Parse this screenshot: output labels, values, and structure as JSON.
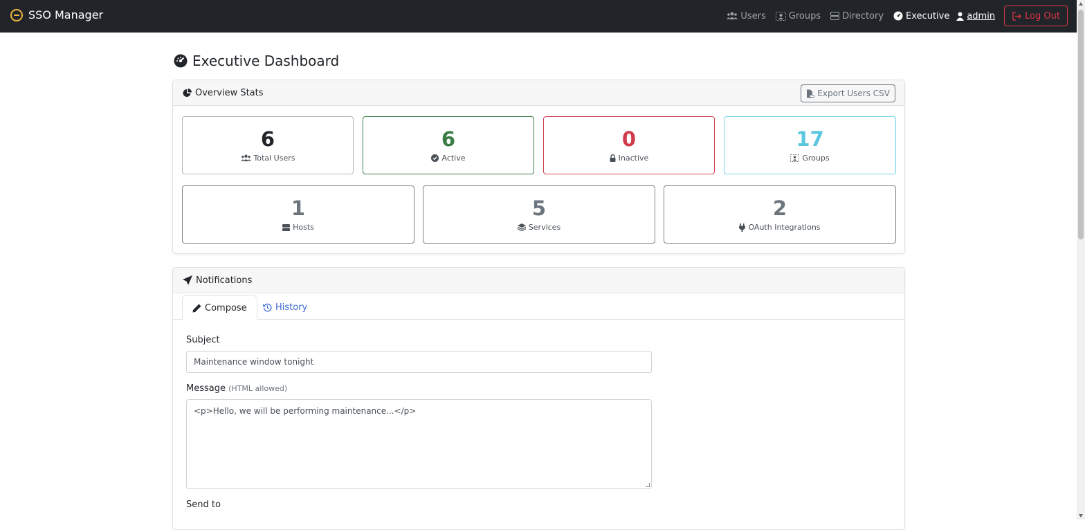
{
  "app": {
    "brand": "SSO Manager"
  },
  "nav": {
    "users": "Users",
    "groups": "Groups",
    "directory": "Directory",
    "executive": "Executive",
    "user": "admin",
    "logout": "Log Out"
  },
  "page": {
    "title": "Executive Dashboard"
  },
  "overview": {
    "header": "Overview Stats",
    "export_label": "Export Users CSV",
    "stats_top": [
      {
        "value": "6",
        "label": "Total Users",
        "color": "#212529",
        "border": "#adb5bd"
      },
      {
        "value": "6",
        "label": "Active",
        "color": "#3a7d44",
        "border": "#3a7d44"
      },
      {
        "value": "0",
        "label": "Inactive",
        "color": "#d13b4b",
        "border": "#d13b4b"
      },
      {
        "value": "17",
        "label": "Groups",
        "color": "#5bc6df",
        "border": "#6fd3ea"
      }
    ],
    "stats_bottom": [
      {
        "value": "1",
        "label": "Hosts",
        "color": "#6c757d",
        "border": "#7b838b"
      },
      {
        "value": "5",
        "label": "Services",
        "color": "#6c757d",
        "border": "#7b838b"
      },
      {
        "value": "2",
        "label": "OAuth Integrations",
        "color": "#6c757d",
        "border": "#7b838b"
      }
    ]
  },
  "notifications": {
    "header": "Notifications",
    "tabs": {
      "compose": "Compose",
      "history": "History"
    },
    "subject_label": "Subject",
    "subject_value": "Maintenance window tonight",
    "message_label": "Message",
    "message_hint": "(HTML allowed)",
    "message_value": "<p>Hello, we will be performing maintenance...</p>",
    "send_to_label": "Send to"
  },
  "colors": {
    "navbar": "#212529",
    "danger": "#dc3545",
    "link": "#3d6ad6",
    "success": "#3a7d44",
    "info": "#5bc6df"
  }
}
